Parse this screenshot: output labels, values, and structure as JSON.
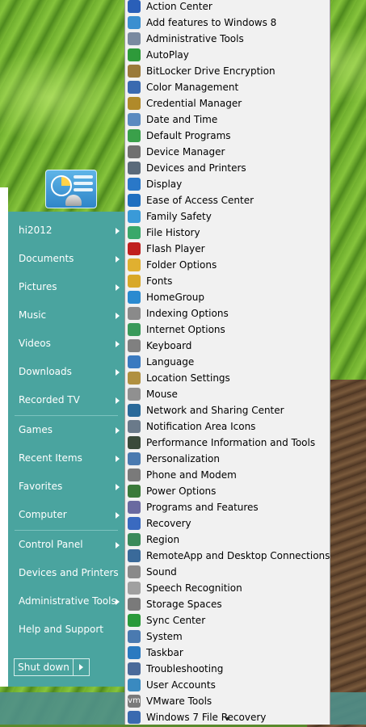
{
  "start_menu": {
    "items": [
      {
        "label": "hi2012",
        "arrow": true
      },
      {
        "label": "Documents",
        "arrow": true
      },
      {
        "label": "Pictures",
        "arrow": true
      },
      {
        "label": "Music",
        "arrow": true
      },
      {
        "label": "Videos",
        "arrow": true
      },
      {
        "label": "Downloads",
        "arrow": true
      },
      {
        "label": "Recorded TV",
        "arrow": true
      },
      {
        "label": "Games",
        "arrow": true
      },
      {
        "label": "Recent Items",
        "arrow": true
      },
      {
        "label": "Favorites",
        "arrow": true
      },
      {
        "label": "Computer",
        "arrow": true
      },
      {
        "label": "Control Panel",
        "arrow": true
      },
      {
        "label": "Devices and Printers",
        "arrow": false
      },
      {
        "label": "Administrative Tools",
        "arrow": true
      },
      {
        "label": "Help and Support",
        "arrow": false
      }
    ],
    "shutdown_label": "Shut down"
  },
  "control_panel_menu": {
    "items": [
      {
        "label": "Action Center",
        "icon": "flag-icon",
        "color": "#2a5fb8"
      },
      {
        "label": "Add features to Windows 8",
        "icon": "windows-features-icon",
        "color": "#3b8fd0"
      },
      {
        "label": "Administrative Tools",
        "icon": "admin-tools-icon",
        "color": "#7a8aa0"
      },
      {
        "label": "AutoPlay",
        "icon": "autoplay-icon",
        "color": "#2e9a3a"
      },
      {
        "label": "BitLocker Drive Encryption",
        "icon": "bitlocker-icon",
        "color": "#9a7a3a"
      },
      {
        "label": "Color Management",
        "icon": "color-management-icon",
        "color": "#3a6ab0"
      },
      {
        "label": "Credential Manager",
        "icon": "credential-icon",
        "color": "#b08a2a"
      },
      {
        "label": "Date and Time",
        "icon": "clock-icon",
        "color": "#5a8ac0"
      },
      {
        "label": "Default Programs",
        "icon": "default-programs-icon",
        "color": "#3aa04a"
      },
      {
        "label": "Device Manager",
        "icon": "device-manager-icon",
        "color": "#707070"
      },
      {
        "label": "Devices and Printers",
        "icon": "printer-icon",
        "color": "#5a6a7a"
      },
      {
        "label": "Display",
        "icon": "display-icon",
        "color": "#2a78c8"
      },
      {
        "label": "Ease of Access Center",
        "icon": "ease-of-access-icon",
        "color": "#1f6fc0"
      },
      {
        "label": "Family Safety",
        "icon": "family-safety-icon",
        "color": "#3a9ad8"
      },
      {
        "label": "File History",
        "icon": "file-history-icon",
        "color": "#3aa86a"
      },
      {
        "label": "Flash Player",
        "icon": "flash-icon",
        "color": "#c0201f"
      },
      {
        "label": "Folder Options",
        "icon": "folder-icon",
        "color": "#e0b030"
      },
      {
        "label": "Fonts",
        "icon": "fonts-icon",
        "color": "#d8a828"
      },
      {
        "label": "HomeGroup",
        "icon": "homegroup-icon",
        "color": "#2a8ad0"
      },
      {
        "label": "Indexing Options",
        "icon": "indexing-icon",
        "color": "#8a8a8a"
      },
      {
        "label": "Internet Options",
        "icon": "internet-icon",
        "color": "#3a9a5a"
      },
      {
        "label": "Keyboard",
        "icon": "keyboard-icon",
        "color": "#808080"
      },
      {
        "label": "Language",
        "icon": "language-icon",
        "color": "#3a7ac0"
      },
      {
        "label": "Location Settings",
        "icon": "location-icon",
        "color": "#b09040"
      },
      {
        "label": "Mouse",
        "icon": "mouse-icon",
        "color": "#909090"
      },
      {
        "label": "Network and Sharing Center",
        "icon": "network-icon",
        "color": "#2a6a9a"
      },
      {
        "label": "Notification Area Icons",
        "icon": "notification-icon",
        "color": "#6a7a8a"
      },
      {
        "label": "Performance Information and Tools",
        "icon": "performance-icon",
        "color": "#3a4a3a"
      },
      {
        "label": "Personalization",
        "icon": "personalization-icon",
        "color": "#4a7ab0"
      },
      {
        "label": "Phone and Modem",
        "icon": "phone-icon",
        "color": "#7a7a7a"
      },
      {
        "label": "Power Options",
        "icon": "power-icon",
        "color": "#3a7a3a"
      },
      {
        "label": "Programs and Features",
        "icon": "programs-icon",
        "color": "#6a6aa0"
      },
      {
        "label": "Recovery",
        "icon": "recovery-icon",
        "color": "#3a6ac0"
      },
      {
        "label": "Region",
        "icon": "region-icon",
        "color": "#3a8a5a"
      },
      {
        "label": "RemoteApp and Desktop Connections",
        "icon": "remoteapp-icon",
        "color": "#3a6a9a"
      },
      {
        "label": "Sound",
        "icon": "speaker-icon",
        "color": "#8a8a8a"
      },
      {
        "label": "Speech Recognition",
        "icon": "microphone-icon",
        "color": "#a0a0a0"
      },
      {
        "label": "Storage Spaces",
        "icon": "storage-icon",
        "color": "#7a7a7a"
      },
      {
        "label": "Sync Center",
        "icon": "sync-icon",
        "color": "#2a9a3a"
      },
      {
        "label": "System",
        "icon": "system-icon",
        "color": "#4a7ab0"
      },
      {
        "label": "Taskbar",
        "icon": "taskbar-icon",
        "color": "#2a7ac0"
      },
      {
        "label": "Troubleshooting",
        "icon": "troubleshooting-icon",
        "color": "#4a6a9a"
      },
      {
        "label": "User Accounts",
        "icon": "user-accounts-icon",
        "color": "#3a8ac0"
      },
      {
        "label": "VMware Tools",
        "icon": "vmware-icon",
        "color": "#7a7a7a",
        "glyph": "vm"
      },
      {
        "label": "Windows 7 File Recovery",
        "icon": "windows-recovery-icon",
        "color": "#3a6ab0"
      }
    ]
  }
}
